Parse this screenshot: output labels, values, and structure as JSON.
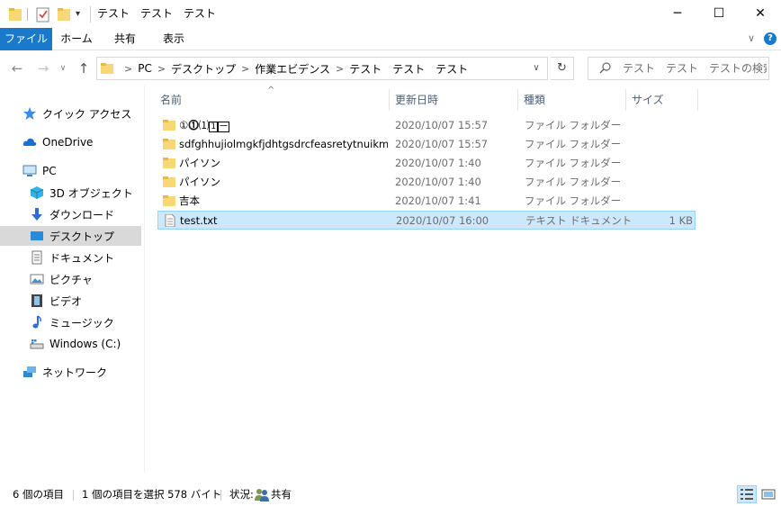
{
  "window": {
    "title": "テスト　テスト　テスト",
    "minimize_glyph": "─",
    "maximize_glyph": "☐",
    "close_glyph": "✕"
  },
  "ribbon": {
    "tabs": [
      "ファイル",
      "ホーム",
      "共有",
      "表示"
    ],
    "expand_glyph": "∨",
    "help_glyph": "?"
  },
  "address": {
    "crumbs": [
      "PC",
      "デスクトップ",
      "作業エビデンス",
      "テスト　テスト　テスト"
    ],
    "crumb_sep": ">",
    "dropdown_glyph": "∨",
    "refresh_glyph": "↻"
  },
  "nav_buttons": {
    "back": "←",
    "forward": "→",
    "recent": "∨",
    "up": "↑"
  },
  "search": {
    "placeholder": "テスト　テスト　テストの検索"
  },
  "nav_pane": {
    "quick_access": "クイック アクセス",
    "onedrive": "OneDrive",
    "pc": "PC",
    "objects3d": "3D オブジェクト",
    "downloads": "ダウンロード",
    "desktop": "デスクトップ",
    "documents": "ドキュメント",
    "pictures": "ピクチャ",
    "videos": "ビデオ",
    "music": "ミュージック",
    "windows_c": "Windows (C:)",
    "network": "ネットワーク"
  },
  "columns": {
    "name": "名前",
    "date": "更新日時",
    "type": "種類",
    "size": "サイズ",
    "sort_glyph": "^"
  },
  "files": [
    {
      "name": "①➀1̲1⃣",
      "display": "①➁1⃞➖",
      "date": "2020/10/07 15:57",
      "type": "ファイル フォルダー",
      "size": "",
      "kind": "folder"
    },
    {
      "name": "sdfghhujiolmgkfjdhtgsdrcfeasretytnuikm...",
      "date": "2020/10/07 15:57",
      "type": "ファイル フォルダー",
      "size": "",
      "kind": "folder"
    },
    {
      "name": "パイソン",
      "date": "2020/10/07 1:40",
      "type": "ファイル フォルダー",
      "size": "",
      "kind": "folder"
    },
    {
      "name": "パイソン",
      "date": "2020/10/07 1:40",
      "type": "ファイル フォルダー",
      "size": "",
      "kind": "folder"
    },
    {
      "name": "吉本",
      "date": "2020/10/07 1:41",
      "type": "ファイル フォルダー",
      "size": "",
      "kind": "folder"
    },
    {
      "name": "test.txt",
      "date": "2020/10/07 16:00",
      "type": "テキスト ドキュメント",
      "size": "1 KB",
      "kind": "text"
    }
  ],
  "status": {
    "count": "6 個の項目",
    "selection": "1 個の項目を選択  578 バイト",
    "state_label": "状況:",
    "state_value": "共有"
  },
  "colors": {
    "accent": "#1979ca",
    "folder": "#f8d775",
    "selection": "#cce8ff"
  }
}
